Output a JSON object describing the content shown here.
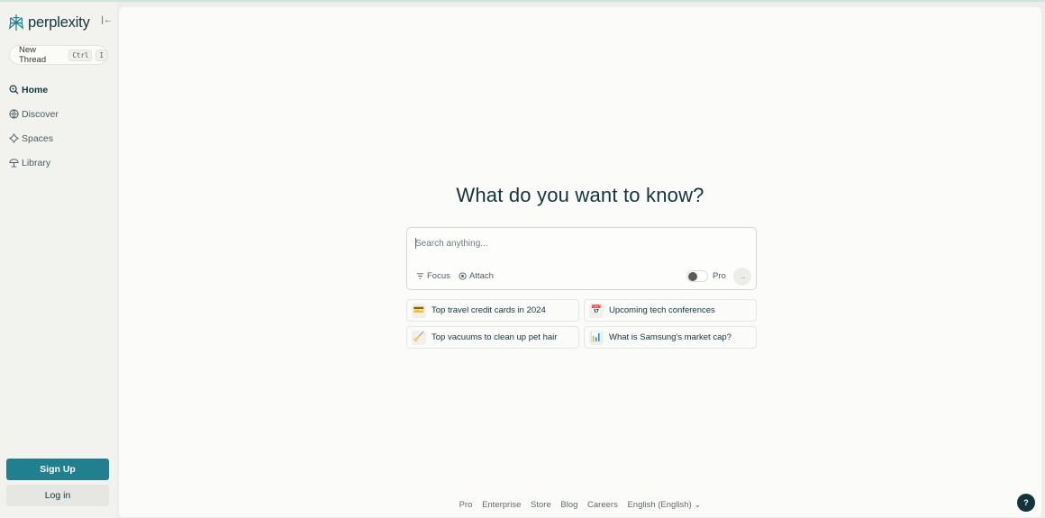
{
  "brand": {
    "name": "perplexity",
    "accent": "#20808d"
  },
  "sidebar": {
    "collapse_icon": "collapse-left-icon",
    "new_thread": {
      "label": "New Thread",
      "shortcut": [
        "Ctrl",
        "I"
      ]
    },
    "items": [
      {
        "label": "Home",
        "icon": "search-icon",
        "active": true
      },
      {
        "label": "Discover",
        "icon": "globe-icon"
      },
      {
        "label": "Spaces",
        "icon": "spaces-icon"
      },
      {
        "label": "Library",
        "icon": "library-icon"
      }
    ],
    "signup_label": "Sign Up",
    "login_label": "Log in"
  },
  "main": {
    "headline": "What do you want to know?",
    "search": {
      "placeholder": "Search anything...",
      "value": ""
    },
    "tools": {
      "focus": "Focus",
      "attach": "Attach",
      "pro": "Pro",
      "pro_enabled": false
    },
    "suggestions": [
      {
        "emoji": "💳",
        "label": "Top travel credit cards in 2024"
      },
      {
        "emoji": "📅",
        "label": "Upcoming tech conferences"
      },
      {
        "emoji": "🧹",
        "label": "Top vacuums to clean up pet hair"
      },
      {
        "emoji": "📊",
        "label": "What is Samsung's market cap?"
      }
    ],
    "footer": [
      "Pro",
      "Enterprise",
      "Store",
      "Blog",
      "Careers",
      "English (English) ⌄"
    ],
    "help_label": "?"
  }
}
